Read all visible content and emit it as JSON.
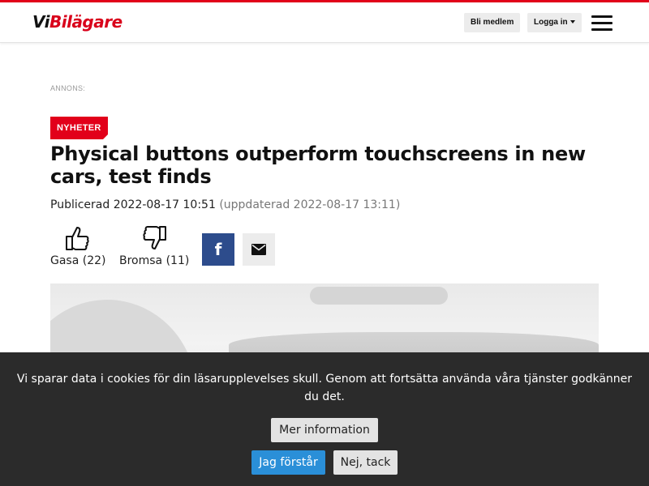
{
  "header": {
    "logo_vi": "Vi",
    "logo_bil": "Bilägare",
    "member_label": "Bli medlem",
    "login_label": "Logga in"
  },
  "ad": {
    "label": "ANNONS:"
  },
  "article": {
    "category": "NYHETER",
    "title": "Physical buttons outperform touchscreens in new cars, test finds",
    "published": "Publicerad 2022-08-17 10:51",
    "updated": "(uppdaterad 2022-08-17 13:11)",
    "reactions": {
      "like_label": "Gasa (22)",
      "dislike_label": "Bromsa (11)"
    },
    "share": {
      "facebook_glyph": "f"
    }
  },
  "cookie": {
    "message": "Vi sparar data i cookies för din läsarupplevelses skull. Genom att fortsätta använda våra tjänster godkänner du det.",
    "more_info_label": "Mer information",
    "accept_label": "Jag förstår",
    "decline_label": "Nej, tack"
  },
  "colors": {
    "brand_red": "#e2001a",
    "facebook_blue": "#2d4c8c",
    "accept_blue": "#2a8fd8",
    "cookie_bg": "#2b2b2b"
  },
  "icons": [
    "thumbs-up-icon",
    "thumbs-down-icon",
    "facebook-icon",
    "mail-icon",
    "hamburger-menu-icon"
  ]
}
